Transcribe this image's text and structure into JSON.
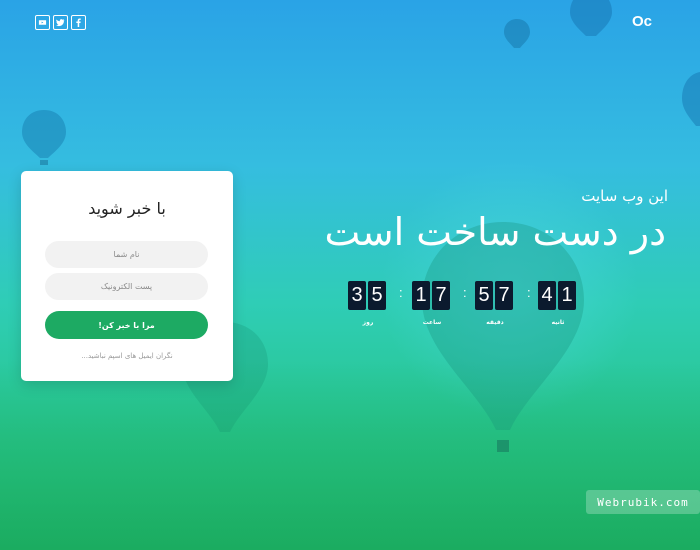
{
  "social": [
    {
      "name": "youtube-icon"
    },
    {
      "name": "twitter-icon"
    },
    {
      "name": "facebook-icon"
    }
  ],
  "logo": "Oc",
  "form": {
    "title": "با خبر شوید",
    "name_placeholder": "نام شما",
    "email_placeholder": "پست الکترونیک",
    "submit_label": "مرا با خبر کن!",
    "note": "نگران ایمیل های اسپم نباشید..."
  },
  "hero": {
    "subtitle": "این وب سایت",
    "headline": "در دست ساخت است"
  },
  "countdown": {
    "days": {
      "digits": [
        "3",
        "5"
      ],
      "label": "روز"
    },
    "hours": {
      "digits": [
        "1",
        "7"
      ],
      "label": "ساعت"
    },
    "minutes": {
      "digits": [
        "5",
        "7"
      ],
      "label": "دقیقه"
    },
    "seconds": {
      "digits": [
        "4",
        "1"
      ],
      "label": "ثانیه"
    },
    "separator": ":"
  },
  "watermark": "Webrubik.com",
  "colors": {
    "accent": "#1daa63",
    "digit_bg": "#0b1a2e",
    "sky_top": "#2aa3e6",
    "ground": "#22c270"
  }
}
